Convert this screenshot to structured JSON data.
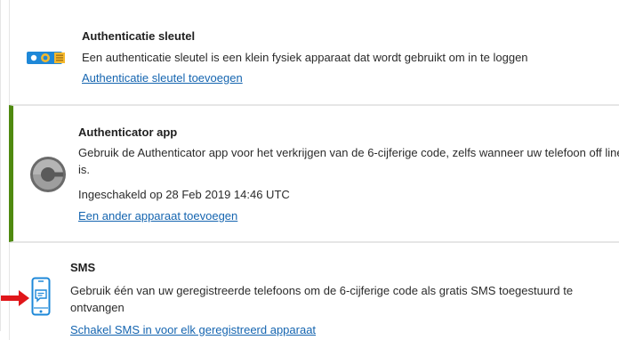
{
  "security_key": {
    "title": "Authenticatie sleutel",
    "description": "Een authenticatie sleutel is een klein fysiek apparaat dat wordt gebruikt om in te loggen",
    "link": "Authenticatie sleutel toevoegen",
    "icon": "usb-key-icon"
  },
  "authenticator_app": {
    "title": "Authenticator app",
    "description": "Gebruik de Authenticator app voor het verkrijgen van de 6-cijferige code, zelfs wanneer uw telefoon off line is.",
    "status": "Ingeschakeld op 28 Feb 2019 14:46 UTC",
    "link": "Een ander apparaat toevoegen",
    "icon": "authenticator-icon",
    "accent_color": "#4f8a10"
  },
  "sms": {
    "title": "SMS",
    "description": "Gebruik één van uw geregistreerde telefoons om de 6-cijferige code als gratis SMS toegestuurd te ontvangen",
    "link": "Schakel SMS in voor elk geregistreerd apparaat",
    "icon": "phone-sms-icon",
    "pointer_color": "#e0161a"
  },
  "link_color": "#1565b0"
}
